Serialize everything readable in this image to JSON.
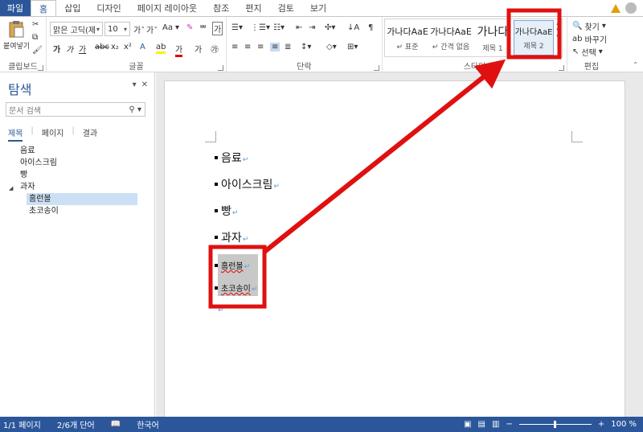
{
  "tabs": [
    {
      "label": "파일"
    },
    {
      "label": "홈"
    },
    {
      "label": "삽입"
    },
    {
      "label": "디자인"
    },
    {
      "label": "페이지 레이아웃"
    },
    {
      "label": "참조"
    },
    {
      "label": "편지"
    },
    {
      "label": "검토"
    },
    {
      "label": "보기"
    }
  ],
  "ribbon": {
    "clipboard": {
      "paste_label": "붙여넣기",
      "group_label": "클립보드"
    },
    "font": {
      "font_name": "맑은 고딕(제목",
      "font_size": "10",
      "aa_label": "Aa",
      "group_label": "글꼴"
    },
    "paragraph": {
      "group_label": "단락"
    },
    "styles": {
      "group_label": "스타일",
      "items": [
        {
          "sample": "가나다AaE",
          "name": "↵ 표준"
        },
        {
          "sample": "가나다AaE",
          "name": "↵ 간격 없음"
        },
        {
          "sample": "가나다",
          "name": "제목 1"
        },
        {
          "sample": "가나다AaE",
          "name": "제목 2"
        }
      ]
    },
    "editing": {
      "find_label": "찾기",
      "replace_label": "바꾸기",
      "select_label": "선택",
      "group_label": "편집"
    }
  },
  "nav": {
    "title": "탐색",
    "search_placeholder": "문서 검색",
    "tabs": [
      {
        "label": "제목"
      },
      {
        "label": "페이지"
      },
      {
        "label": "결과"
      }
    ],
    "headings": [
      {
        "text": "음료"
      },
      {
        "text": "아이스크림"
      },
      {
        "text": "빵"
      },
      {
        "text": "과자"
      },
      {
        "text": "홈런볼"
      },
      {
        "text": "초코송이"
      }
    ]
  },
  "document": {
    "items": [
      {
        "text": "음료"
      },
      {
        "text": "아이스크림"
      },
      {
        "text": "빵"
      },
      {
        "text": "과자"
      },
      {
        "text": "홈런볼"
      },
      {
        "text": "초코송이"
      }
    ],
    "para_mark": "↵"
  },
  "status": {
    "page": "1/1 페이지",
    "words": "2/6개 단어",
    "language": "한국어",
    "zoom": "100 %"
  },
  "colors": {
    "accent": "#2b579a",
    "annotation": "#e01010"
  }
}
